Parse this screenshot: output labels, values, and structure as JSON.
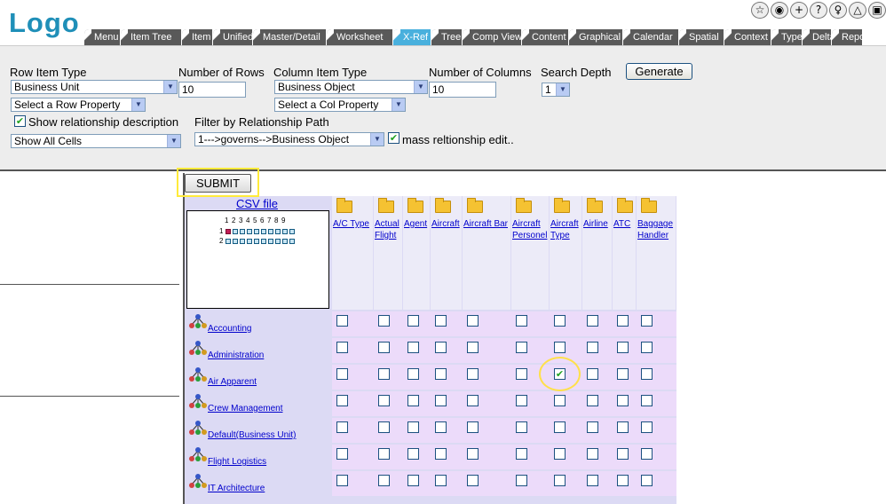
{
  "header": {
    "logo": "Logo",
    "toolbar_icons": [
      "star-icon",
      "globe-icon",
      "plus-icon",
      "help-icon",
      "bulb-icon",
      "triangle-icon",
      "window-icon"
    ],
    "tabs": [
      {
        "label": "Menu",
        "active": false
      },
      {
        "label": "Item Tree",
        "active": false
      },
      {
        "label": "Item",
        "active": false
      },
      {
        "label": "Unified",
        "active": false
      },
      {
        "label": "Master/Detail",
        "active": false
      },
      {
        "label": "Worksheet",
        "active": false
      },
      {
        "label": "X-Ref",
        "active": true
      },
      {
        "label": "Tree",
        "active": false
      },
      {
        "label": "Comp View",
        "active": false
      },
      {
        "label": "Content",
        "active": false
      },
      {
        "label": "Graphical",
        "active": false
      },
      {
        "label": "Calendar",
        "active": false
      },
      {
        "label": "Spatial",
        "active": false
      },
      {
        "label": "Context",
        "active": false
      },
      {
        "label": "Type",
        "active": false
      },
      {
        "label": "Delta",
        "active": false
      },
      {
        "label": "Repor",
        "active": false
      }
    ]
  },
  "controls": {
    "row_item_type_label": "Row Item Type",
    "row_item_type_value": "Business Unit",
    "row_property_value": "Select a Row Property",
    "num_rows_label": "Number of Rows",
    "num_rows_value": "10",
    "col_item_type_label": "Column Item Type",
    "col_item_type_value": "Business Object",
    "col_property_value": "Select a Col Property",
    "num_cols_label": "Number of Columns",
    "num_cols_value": "10",
    "search_depth_label": "Search Depth",
    "search_depth_value": "1",
    "generate_label": "Generate",
    "show_rel_desc_label": "Show relationship description",
    "show_rel_desc_checked": true,
    "show_cells_value": "Show All Cells",
    "filter_label": "Filter by Relationship Path",
    "filter_value": "1--->governs-->Business Object",
    "mass_edit_label": "mass reltionship edit..",
    "mass_edit_checked": true
  },
  "matrix": {
    "submit_label": "SUBMIT",
    "csv_label": "CSV file",
    "mini_numbers": [
      "1",
      "2",
      "3",
      "4",
      "5",
      "6",
      "7",
      "8",
      "9"
    ],
    "mini_rows": [
      "1",
      "2"
    ],
    "columns": [
      {
        "lines": [
          "A/C Type"
        ]
      },
      {
        "lines": [
          "Actual",
          "Flight"
        ]
      },
      {
        "lines": [
          "Agent"
        ]
      },
      {
        "lines": [
          "Aircraft"
        ]
      },
      {
        "lines": [
          "Aircraft Bar"
        ]
      },
      {
        "lines": [
          "Aircraft",
          "Personel"
        ]
      },
      {
        "lines": [
          "Aircraft",
          "Type"
        ]
      },
      {
        "lines": [
          "Airline"
        ]
      },
      {
        "lines": [
          "ATC"
        ]
      },
      {
        "lines": [
          "Baggage",
          "Handler"
        ]
      }
    ],
    "rows": [
      {
        "label": "Accounting",
        "checked": []
      },
      {
        "label": "Administration",
        "checked": []
      },
      {
        "label": "Air Apparent",
        "checked": [
          6
        ]
      },
      {
        "label": "Crew Management",
        "checked": []
      },
      {
        "label": "Default(Business Unit)",
        "checked": []
      },
      {
        "label": "Flight Logistics",
        "checked": []
      },
      {
        "label": "IT Architecture",
        "checked": []
      }
    ]
  },
  "colors": {
    "accent_tab": "#49b0dd",
    "tab": "#595959",
    "highlight": "#ffeb3b",
    "grid_bg": "#dcdaf4",
    "cell_bg": "#ecdbfa"
  }
}
